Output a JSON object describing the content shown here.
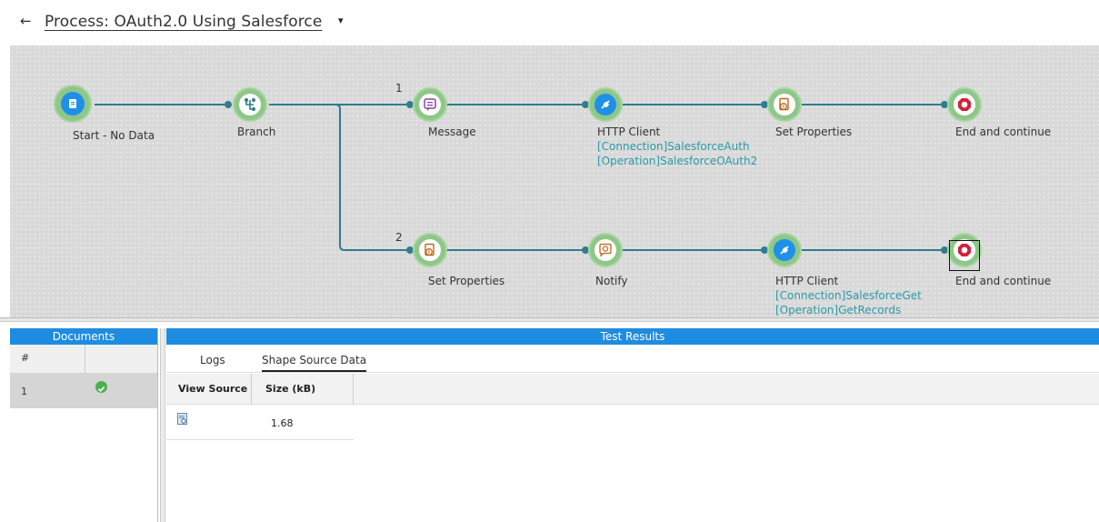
{
  "header": {
    "back_glyph": "←",
    "title": "Process: OAuth2.0 Using Salesforce",
    "caret_glyph": "▾"
  },
  "canvas": {
    "branch_numbers": [
      "1",
      "2"
    ],
    "nodes": [
      {
        "label": "Start - No Data",
        "icon": "start-document-icon"
      },
      {
        "label": "Branch",
        "icon": "branch-icon"
      },
      {
        "label": "Message",
        "icon": "message-icon"
      },
      {
        "label": "HTTP Client",
        "icon": "http-client-icon",
        "sub1": "[Connection]SalesforceAuth",
        "sub2": "[Operation]SalesforceOAuth2"
      },
      {
        "label": "Set Properties",
        "icon": "set-properties-icon"
      },
      {
        "label": "End and continue",
        "icon": "stop-hand-icon"
      },
      {
        "label": "Set Properties",
        "icon": "set-properties-icon"
      },
      {
        "label": "Notify",
        "icon": "notify-icon"
      },
      {
        "label": "HTTP Client",
        "icon": "http-client-icon",
        "sub1": "[Connection]SalesforceGet",
        "sub2": "[Operation]GetRecords"
      },
      {
        "label": "End and continue",
        "icon": "stop-hand-icon"
      }
    ]
  },
  "documents": {
    "title": "Documents",
    "col_hash": "#",
    "rows": [
      {
        "num": "1",
        "status": "ok"
      }
    ]
  },
  "results": {
    "title": "Test Results",
    "tabs": [
      "Logs",
      "Shape Source Data"
    ],
    "active_tab": "Shape Source Data",
    "columns": [
      "View Source",
      "Size (kB)"
    ],
    "rows": [
      {
        "size": "1.68"
      }
    ]
  },
  "colors": {
    "accent": "#1e8ce0",
    "node_ring": "#8fc689",
    "connector": "#2f7d8e",
    "sub_text": "#2a9aa8"
  }
}
